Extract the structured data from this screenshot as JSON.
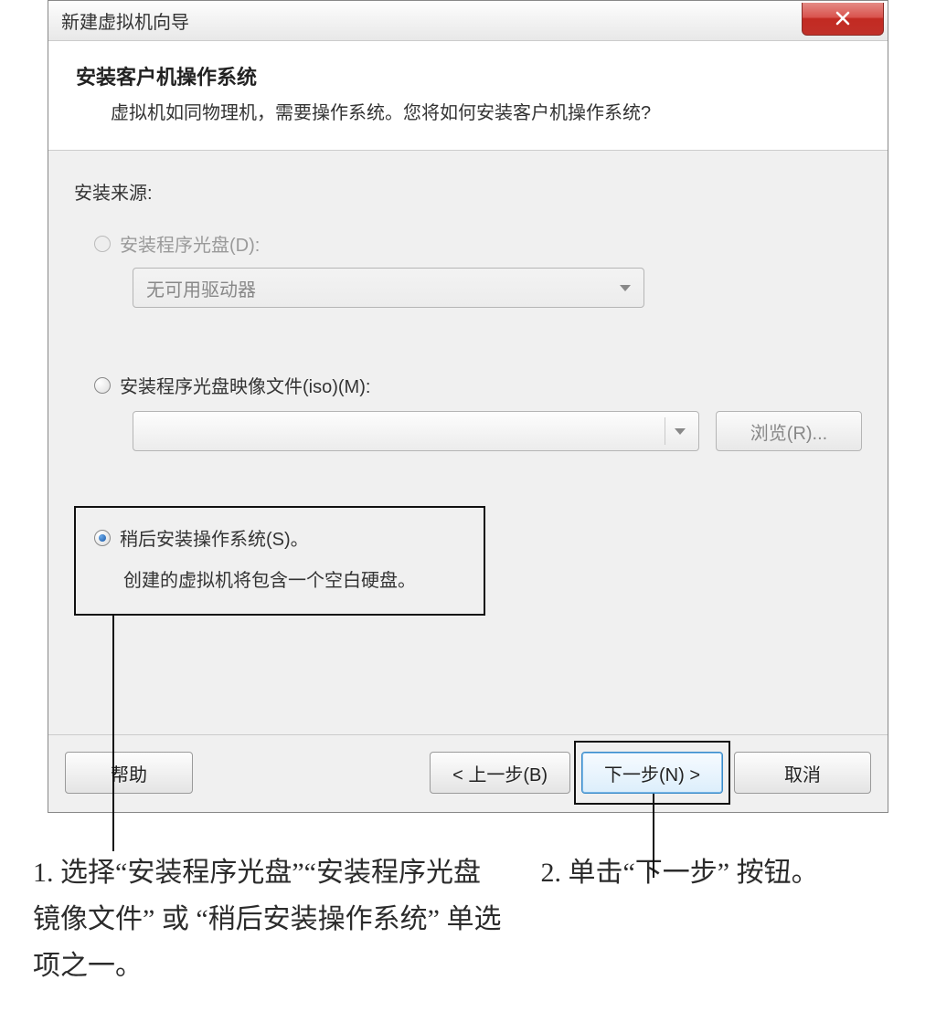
{
  "window": {
    "title": "新建虚拟机向导"
  },
  "header": {
    "title": "安装客户机操作系统",
    "subtitle": "虚拟机如同物理机，需要操作系统。您将如何安装客户机操作系统?"
  },
  "source": {
    "label": "安装来源:",
    "opt_disc": {
      "label": "安装程序光盘(D):",
      "dropdown": "无可用驱动器"
    },
    "opt_iso": {
      "label": "安装程序光盘映像文件(iso)(M):",
      "browse": "浏览(R)..."
    },
    "opt_later": {
      "label": "稍后安装操作系统(S)。",
      "desc": "创建的虚拟机将包含一个空白硬盘。"
    }
  },
  "footer": {
    "help": "帮助",
    "back": "< 上一步(B)",
    "next": "下一步(N) >",
    "cancel": "取消"
  },
  "notes": {
    "n1": "1. 选择“安装程序光盘”“安装程序光盘镜像文件” 或 “稍后安装操作系统” 单选项之一。",
    "n2": "2. 单击“下一步” 按钮。"
  }
}
